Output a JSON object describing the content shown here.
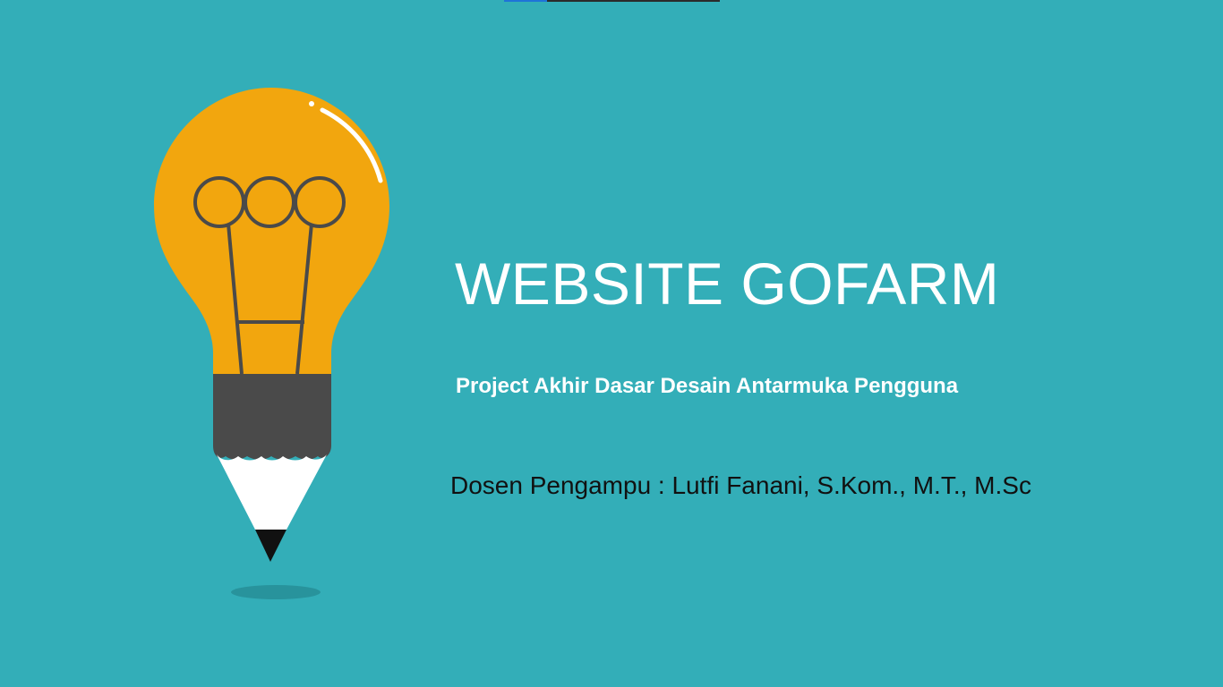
{
  "slide": {
    "title": "WEBSITE GOFARM",
    "subtitle": "Project Akhir Dasar Desain Antarmuka Pengguna",
    "lecturer": "Dosen Pengampu : Lutfi Fanani, S.Kom., M.T., M.Sc"
  },
  "illustration": {
    "icon": "lightbulb-pencil-icon"
  },
  "colors": {
    "background": "#33aeb8",
    "bulb": "#f2a60e",
    "outline": "#4a4a4a",
    "pencil_body": "#4a4a4a",
    "pencil_tip": "#ffffff",
    "pencil_lead": "#111111",
    "highlight": "#ffffff",
    "top_bar_accent": "#1e73d8"
  }
}
